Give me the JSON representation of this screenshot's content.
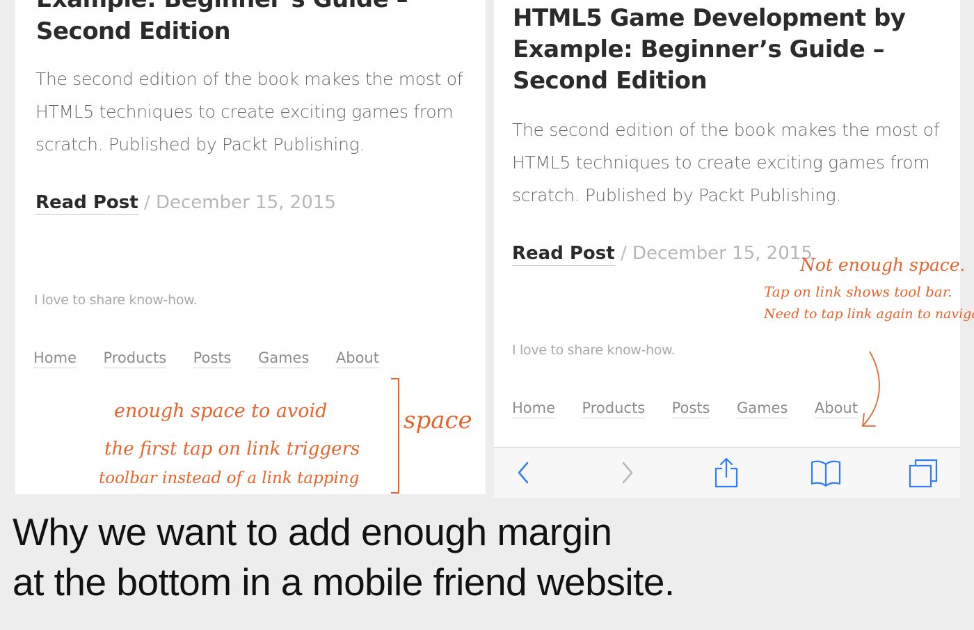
{
  "left": {
    "title_line1": "Example: Beginner’s Guide –",
    "title_line2": "Second Edition",
    "excerpt": "The second edition of the book makes the most of HTML5 techniques to create exciting games from scratch. Published by Packt Publishing.",
    "read_post": "Read Post",
    "separator": "/",
    "date": "December 15, 2015",
    "tagline": "I love to share know-how.",
    "nav": [
      "Home",
      "Products",
      "Posts",
      "Games",
      "About"
    ],
    "annotation_lines": [
      "enough space to avoid",
      "the first tap on link triggers",
      "toolbar instead of a link tapping"
    ],
    "annotation_space": "space"
  },
  "right": {
    "title_lines": [
      "HTML5 Game Development by",
      "Example: Beginner’s Guide –",
      "Second Edition"
    ],
    "excerpt": "The second edition of the book makes the most of HTML5 techniques to create exciting games from scratch. Published by Packt Publishing.",
    "read_post": "Read Post",
    "separator": "/",
    "date": "December 15, 2015",
    "tagline": "I love to share know-how.",
    "nav": [
      "Home",
      "Products",
      "Posts",
      "Games",
      "About"
    ],
    "annotation_lines": [
      "Not enough space.",
      "Tap on link shows tool bar.",
      "Need to tap link again to navigate"
    ],
    "toolbar_icons": [
      "back-icon",
      "forward-icon",
      "share-icon",
      "bookmarks-icon",
      "tabs-icon"
    ]
  },
  "caption_lines": [
    "Why we want to add enough margin",
    "at the bottom in a mobile friend website."
  ],
  "colors": {
    "annotation": "#e8642d",
    "ios_blue": "#2f7cf6",
    "background": "#ededed"
  }
}
